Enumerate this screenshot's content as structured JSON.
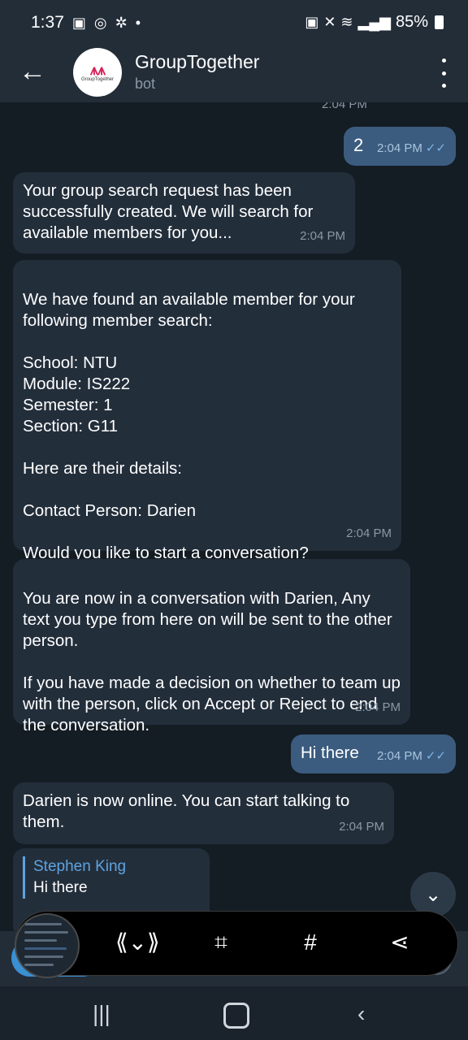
{
  "status_bar": {
    "time": "1:37",
    "battery": "85%"
  },
  "header": {
    "title": "GroupTogether",
    "subtitle": "bot",
    "avatar_text": "GroupTogether"
  },
  "chat": {
    "partial_time": "2:04 PM",
    "messages": [
      {
        "text": "2",
        "time": "2:04 PM"
      },
      {
        "text": "Your group search request has been successfully created. We will search for available members for you...",
        "time": "2:04 PM"
      },
      {
        "text": "We have found an available member for your following member search:\n\nSchool: NTU\nModule: IS222\nSemester: 1\nSection: G11\n\nHere are their details:\n\nContact Person: Darien\n\nWould you like to start a conversation?",
        "time": "2:04 PM"
      },
      {
        "text": "You are now in a conversation with Darien, Any text you type from here on will be sent to the other person.\n\nIf you have made a decision on whether to team up with the person, click on Accept or Reject to end the conversation.",
        "time": "2:04 PM"
      },
      {
        "text": "Hi there",
        "time": "2:04 PM"
      },
      {
        "text": "Darien is now online. You can start talking to them.",
        "time": "2:04 PM"
      },
      {
        "reply_name": "Stephen King",
        "reply_text": "Hi there"
      }
    ]
  },
  "icons": [
    "back-arrow-icon",
    "more-vert-icon",
    "chevron-down-icon",
    "scroll-capture-icon",
    "crop-edit-icon",
    "hashtag-icon",
    "share-icon"
  ]
}
